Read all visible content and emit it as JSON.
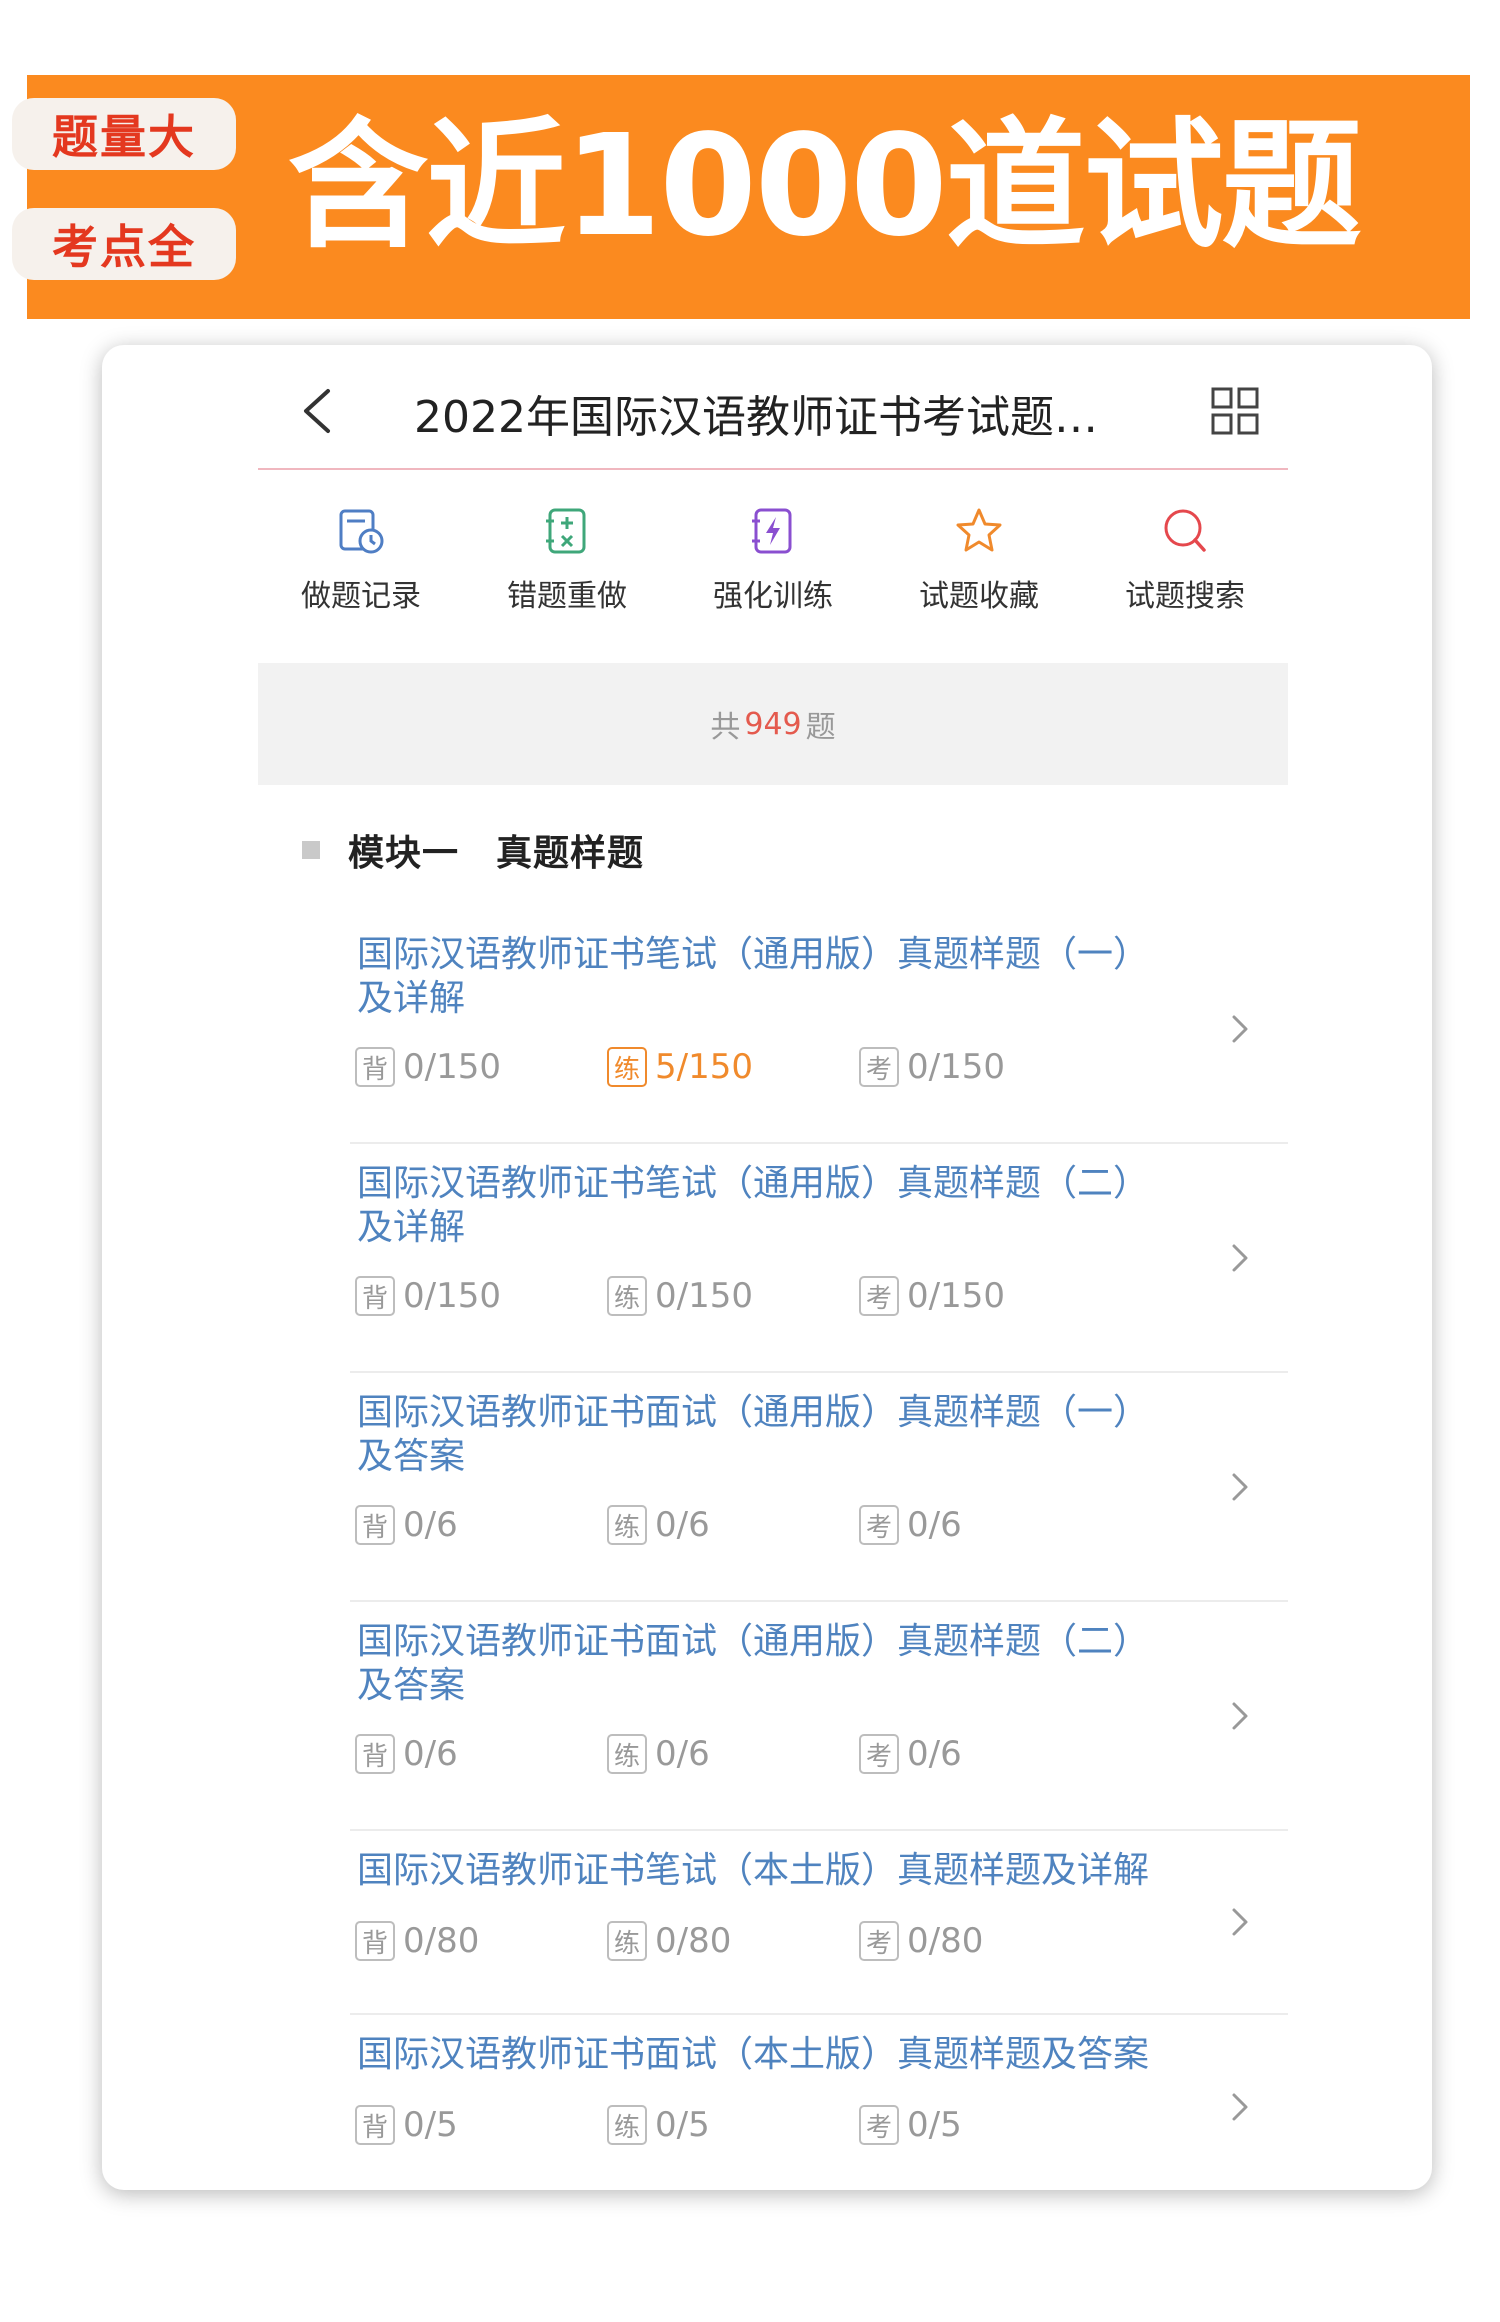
{
  "banner": {
    "tag_top": "题量大",
    "tag_bottom": "考点全",
    "headline": "含近1000道试题"
  },
  "navbar": {
    "title": "2022年国际汉语教师证书考试题…"
  },
  "tools": [
    {
      "label": "做题记录",
      "icon": "history-icon"
    },
    {
      "label": "错题重做",
      "icon": "wrong-question-icon"
    },
    {
      "label": "强化训练",
      "icon": "lightning-icon"
    },
    {
      "label": "试题收藏",
      "icon": "star-icon"
    },
    {
      "label": "试题搜索",
      "icon": "search-icon"
    }
  ],
  "summary": {
    "prefix": "共",
    "total": "949",
    "suffix": "题"
  },
  "module": {
    "title": "模块一　真题样题"
  },
  "items": [
    {
      "title": "国际汉语教师证书笔试（通用版）真题样题（一）及详解",
      "recite": "0/150",
      "practice": "5/150",
      "exam": "0/150"
    },
    {
      "title": "国际汉语教师证书笔试（通用版）真题样题（二）及详解",
      "recite": "0/150",
      "practice": "0/150",
      "exam": "0/150"
    },
    {
      "title": "国际汉语教师证书面试（通用版）真题样题（一）及答案",
      "recite": "0/6",
      "practice": "0/6",
      "exam": "0/6"
    },
    {
      "title": "国际汉语教师证书面试（通用版）真题样题（二）及答案",
      "recite": "0/6",
      "practice": "0/6",
      "exam": "0/6"
    },
    {
      "title": "国际汉语教师证书笔试（本土版）真题样题及详解",
      "recite": "0/80",
      "practice": "0/80",
      "exam": "0/80"
    },
    {
      "title": "国际汉语教师证书面试（本土版）真题样题及答案",
      "recite": "0/5",
      "practice": "0/5",
      "exam": "0/5"
    }
  ],
  "badges": {
    "recite": "背",
    "practice": "练",
    "exam": "考"
  },
  "colors": {
    "banner": "#fb8a1f",
    "tag_text": "#e4381f",
    "link": "#4f83bf",
    "active": "#f08a2c",
    "count": "#e45a4e"
  }
}
